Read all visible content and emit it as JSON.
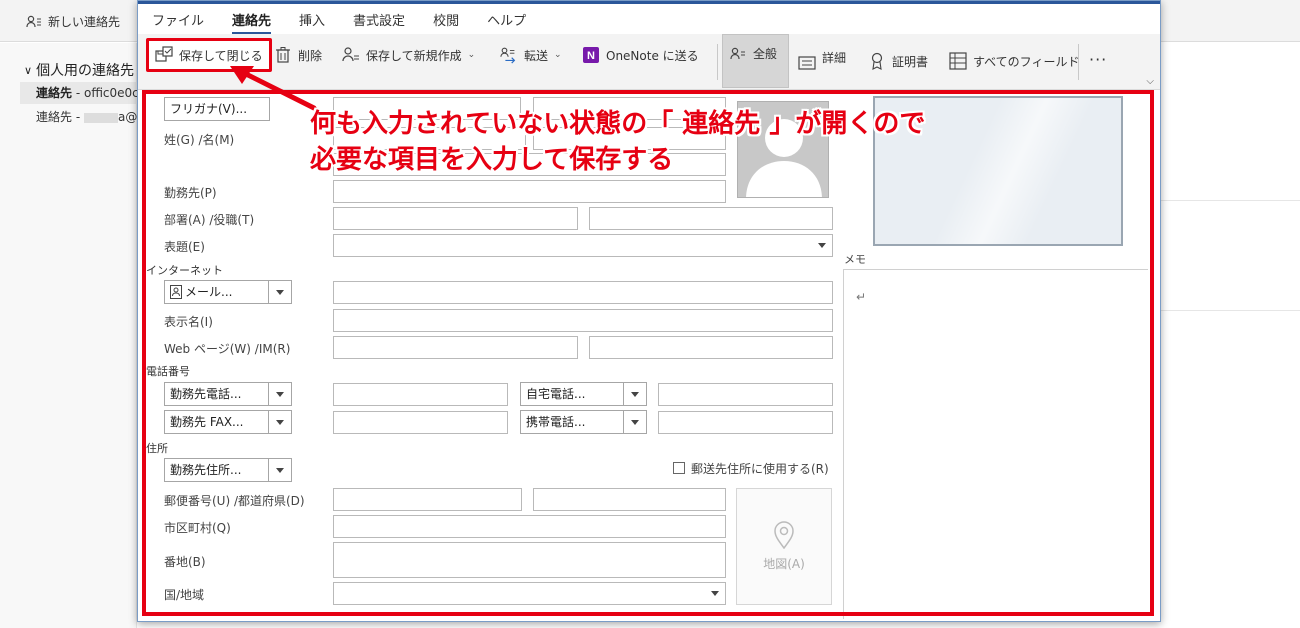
{
  "background": {
    "new_contact": "新しい連絡先",
    "group_title": "個人用の連絡先",
    "row1_label": "連絡先",
    "row1_value": " - offic0e0c",
    "row2_label": "連絡先 - ",
    "row2_value": "a@"
  },
  "menu": {
    "tabs": [
      "ファイル",
      "連絡先",
      "挿入",
      "書式設定",
      "校閲",
      "ヘルプ"
    ],
    "active_index": 1
  },
  "ribbon": {
    "save_close": "保存して閉じる",
    "delete": "削除",
    "save_new": "保存して新規作成",
    "forward": "転送",
    "onenote": "OneNote に送る",
    "general": "全般",
    "details": "詳細",
    "certificates": "証明書",
    "all_fields": "すべてのフィールド",
    "more": "···"
  },
  "form": {
    "furigana_btn": "フリガナ(V)...",
    "name_label": "姓(G) /名(M)",
    "company_label": "勤務先(P)",
    "dept_label": "部署(A) /役職(T)",
    "title_label": "表題(E)",
    "internet_section": "インターネット",
    "email_dd": "メール...",
    "display_name_label": "表示名(I)",
    "web_label": "Web ページ(W) /IM(R)",
    "phone_section": "電話番号",
    "phone_work": "勤務先電話...",
    "phone_home": "自宅電話...",
    "phone_fax": "勤務先 FAX...",
    "phone_mobile": "携帯電話...",
    "address_section": "住所",
    "address_dd": "勤務先住所...",
    "mailing_checkbox": "郵送先住所に使用する(R)",
    "postal_label": "郵便番号(U) /都道府県(D)",
    "city_label": "市区町村(Q)",
    "street_label": "番地(B)",
    "country_label": "国/地域",
    "map_btn": "地図(A)",
    "memo_label": "メモ",
    "memo_content": "↵"
  },
  "annotation": {
    "line1": "何も入力されていない状態の「 連絡先 」が開くので",
    "line2": "必要な項目を入力して保存する",
    "color": "#e60012"
  }
}
